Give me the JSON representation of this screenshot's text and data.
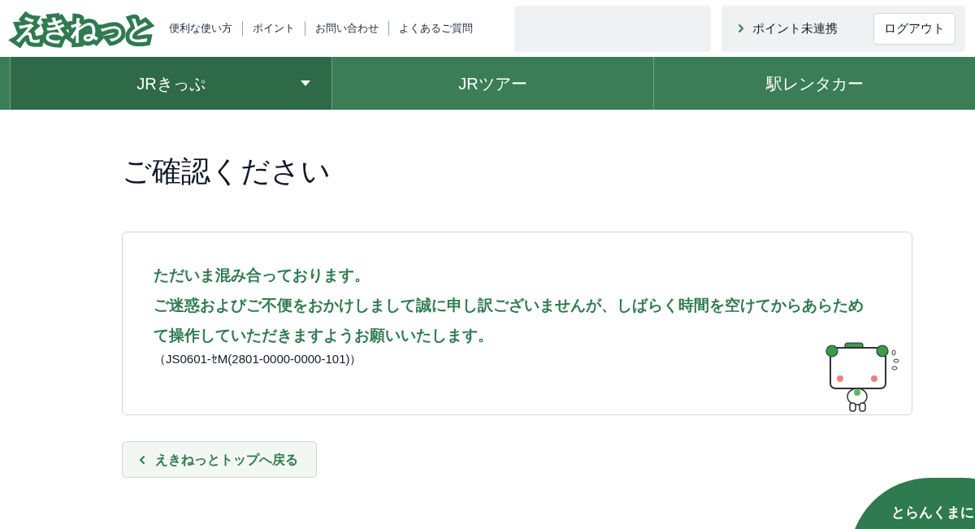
{
  "logo": "えきねっと",
  "header_links": [
    "便利な使い方",
    "ポイント",
    "お問い合わせ",
    "よくあるご質問"
  ],
  "account": {
    "points_link": "ポイント未連携",
    "logout": "ログアウト"
  },
  "nav_tabs": [
    {
      "label": "JRきっぷ",
      "selected": true,
      "has_dropdown": true
    },
    {
      "label": "JRツアー",
      "selected": false,
      "has_dropdown": false
    },
    {
      "label": "駅レンタカー",
      "selected": false,
      "has_dropdown": false
    }
  ],
  "page_title": "ご確認ください",
  "message": {
    "lines": [
      "ただいま混み合っております。",
      "ご迷惑およびご不便をおかけしまして誠に申し訳ございませんが、しばらく時間を空けてからあらためて操作していただきますようお願いいたします。"
    ],
    "code": "（JS0601-ｾM(2801-0000-0000-101)）"
  },
  "back_button": "えきねっとトップへ戻る",
  "chat_bubble": "とらんくまに"
}
